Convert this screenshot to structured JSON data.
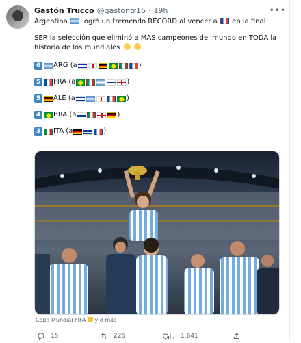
{
  "tweet": {
    "author_name": "Gastón Trucco",
    "author_handle": "@gastontr16",
    "separator": "·",
    "time": "19h",
    "line1_a": "Argentina",
    "line1_b": "logró un tremendo RÉCORD al vencer a",
    "line1_c": "en la final",
    "paragraph2": "SER la selección que eliminó a MÁS campeones del mundo en TODA la historia de los mundiales",
    "stats": [
      {
        "count": "6",
        "team": "ARG (a",
        "close": ")"
      },
      {
        "count": "5",
        "team": "FRA (a",
        "close": ")"
      },
      {
        "count": "5",
        "team": "ALE (a",
        "close": ")"
      },
      {
        "count": "4",
        "team": "BRA (a",
        "close": ")"
      },
      {
        "count": "3",
        "team": "ITA (a",
        "close": ")"
      }
    ],
    "media_caption": "Copa Mundial FIFA",
    "media_caption_suffix": "y 8 más",
    "replies": "15",
    "retweets": "225",
    "views": "1.641"
  },
  "icons": {
    "more": "more-icon",
    "reply": "reply-icon",
    "retweet": "retweet-icon",
    "like": "like-icon",
    "views": "views-icon",
    "share": "share-icon"
  },
  "colors": {
    "accent": "#1d9bf0",
    "muted": "#536471",
    "keycap": "#3b88c3"
  }
}
